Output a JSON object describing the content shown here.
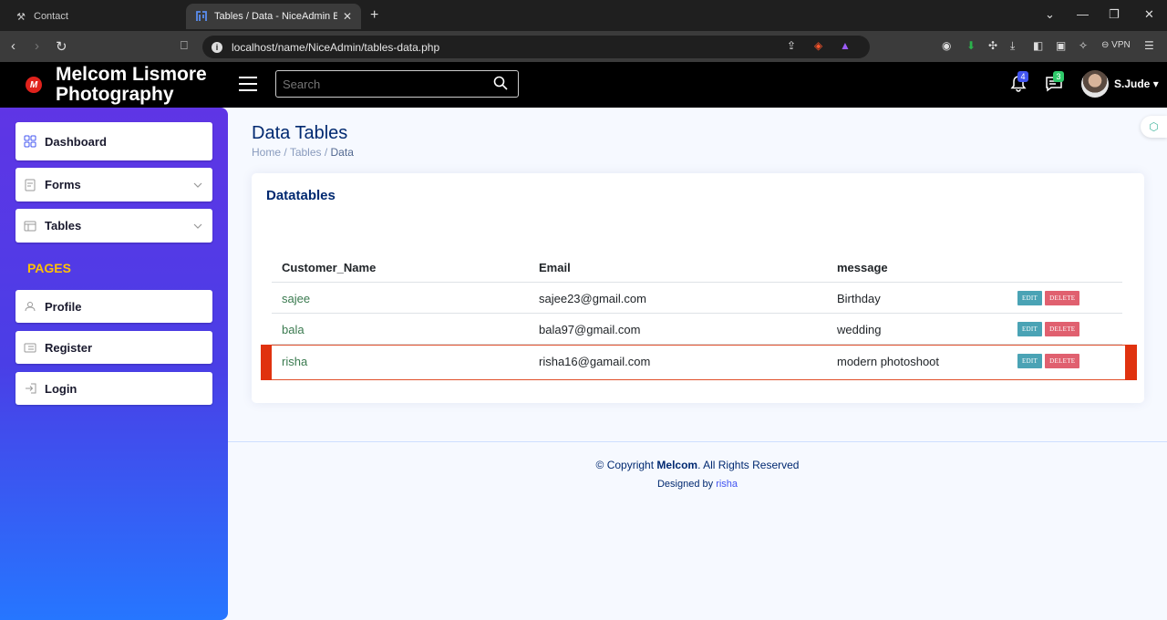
{
  "browser": {
    "tabs": [
      {
        "title": "Contact",
        "active": false
      },
      {
        "title": "Tables / Data - NiceAdmin Boot",
        "active": true
      }
    ],
    "new_tab": "+",
    "url": "localhost/name/NiceAdmin/tables-data.php",
    "vpn_label": "VPN"
  },
  "header": {
    "brand_line1": "Melcom Lismore",
    "brand_line2": "Photography",
    "search_placeholder": "Search",
    "notifications_count": "4",
    "messages_count": "3",
    "username": "S.Jude"
  },
  "sidebar": {
    "items": [
      {
        "label": "Dashboard",
        "icon": "grid-icon"
      },
      {
        "label": "Forms",
        "icon": "journal-icon",
        "expandable": true
      },
      {
        "label": "Tables",
        "icon": "layout-text-icon",
        "expandable": true
      }
    ],
    "pages_heading": "PAGES",
    "pages": [
      {
        "label": "Profile",
        "icon": "person-icon"
      },
      {
        "label": "Register",
        "icon": "card-list-icon"
      },
      {
        "label": "Login",
        "icon": "box-arrow-in-right-icon"
      }
    ]
  },
  "main": {
    "page_title": "Data Tables",
    "breadcrumb": [
      "Home",
      "Tables",
      "Data"
    ],
    "card_title": "Datatables",
    "table": {
      "headers": [
        "Customer_Name",
        "Email",
        "message"
      ],
      "rows": [
        {
          "name": "sajee",
          "email": "sajee23@gmail.com",
          "message": "Birthday"
        },
        {
          "name": "bala",
          "email": "bala97@gmail.com",
          "message": "wedding"
        },
        {
          "name": "risha",
          "email": "risha16@gamail.com",
          "message": "modern photoshoot"
        }
      ],
      "edit_label": "EDIT",
      "delete_label": "DELETE"
    }
  },
  "footer": {
    "copyright_prefix": "© Copyright",
    "copyright_brand": "Melcom",
    "copyright_suffix": ". All Rights Reserved",
    "designed_prefix": "Designed by",
    "designed_by": "risha"
  },
  "colors": {
    "sidebar_top": "#5f35e5",
    "sidebar_bottom": "#2676ff",
    "pages_heading": "#ffc107",
    "edit_button": "#4aa3b5",
    "delete_button": "#e0606f",
    "highlight": "#e0320f"
  }
}
